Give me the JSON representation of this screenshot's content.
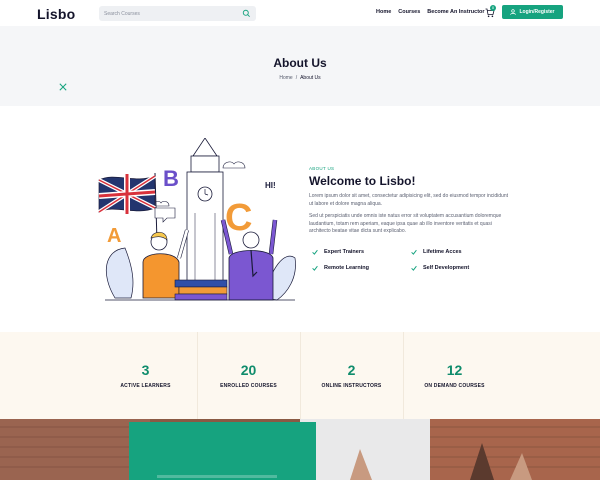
{
  "header": {
    "logo": "Lisbo",
    "search_placeholder": "Search Courses",
    "nav": [
      "Home",
      "Courses",
      "Become An Instructor"
    ],
    "cart_count": "0",
    "login_label": "Login/Register"
  },
  "banner": {
    "title": "About Us",
    "breadcrumb": [
      "Home",
      "About Us"
    ]
  },
  "about": {
    "eyebrow": "ABOUT US",
    "title": "Welcome to Lisbo!",
    "p1": "Lorem ipsum dolor sit amet, consectetur adipisicing elit, sed do eiusmod tempor incididunt ut labore et dolore magna aliqua.",
    "p2": "Sed ut perspiciatis unde omnis iste natus error sit voluptatem accusantium doloremque laudantium, totam rem aperiam, eaque ipsa quae ab illo inventore veritatis et quasi architecto beatae vitae dicta sunt explicabo.",
    "features": [
      "Expert Trainers",
      "Lifetime Acces",
      "Remote Learning",
      "Self Development"
    ],
    "illustration_letters": [
      "A",
      "B",
      "C"
    ],
    "speech_text": "HI!"
  },
  "stats": [
    {
      "num": "3",
      "label": "ACTIVE LEARNERS"
    },
    {
      "num": "20",
      "label": "ENROLLED COURSES"
    },
    {
      "num": "2",
      "label": "ONLINE INSTRUCTORS"
    },
    {
      "num": "12",
      "label": "ON DEMAND COURSES"
    }
  ],
  "colors": {
    "accent": "#16a37f",
    "stat_number": "#0f8c6c",
    "stats_bg": "#fdf8f0",
    "banner_bg": "#f5f6f8"
  }
}
